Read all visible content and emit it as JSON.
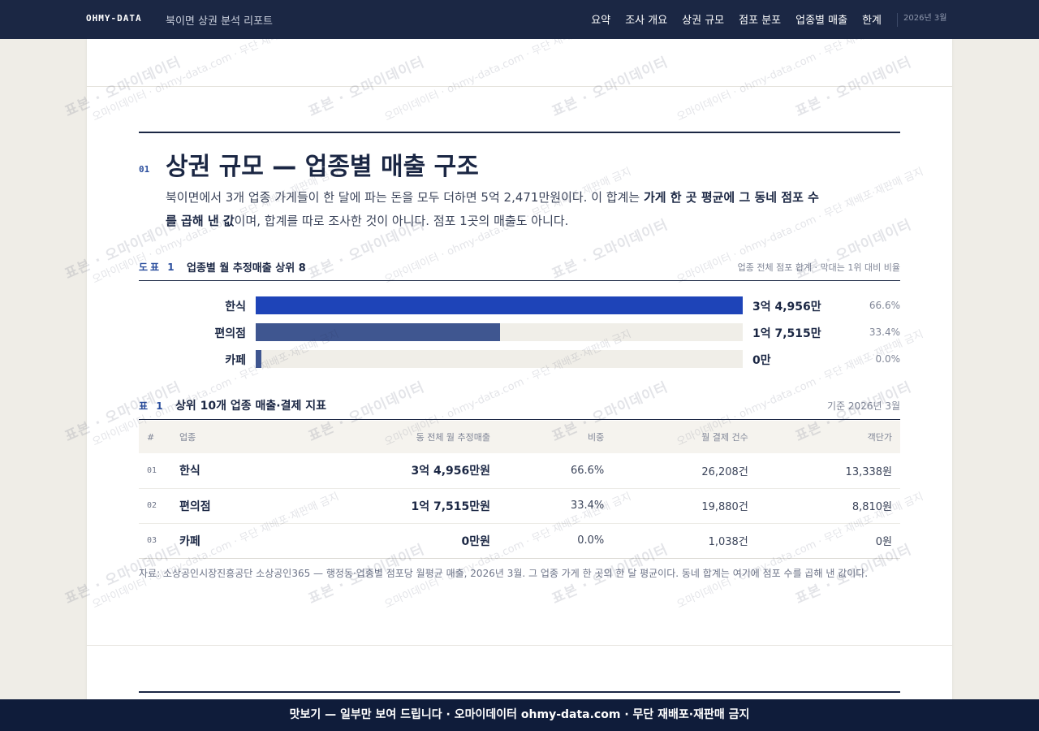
{
  "topbar": {
    "brand": "OHMY-DATA",
    "title": "북이면 상권 분석 리포트",
    "nav": [
      "요약",
      "조사 개요",
      "상권 규모",
      "점포 분포",
      "업종별 매출",
      "한계"
    ],
    "date": "2026년 3월"
  },
  "section": {
    "number": "01",
    "title": "상권 규모 — 업종별 매출 구조",
    "lead_1": "북이면에서 3개 업종 가게들이 한 달에 파는 돈을 모두 더하면 5억 2,471만원이다. 이 합계는 ",
    "lead_bold": "가게 한 곳 평균에 그 동네 점포 수를 곱해 낸 값",
    "lead_2": "이며, 합계를 따로 조사한 것이 아니다. 점포 1곳의 매출도 아니다."
  },
  "figure": {
    "label": "도표 1",
    "title": "업종별 월 추정매출 상위 8",
    "note": "업종 전체 점포 합계 · 막대는 1위 대비 비율",
    "colors": [
      "#1e44b8",
      "#3f5690",
      "#3f5690"
    ]
  },
  "chart_data": {
    "type": "bar",
    "categories": [
      "한식",
      "편의점",
      "카페"
    ],
    "values": [
      1,
      0.502,
      0.012
    ],
    "value_labels": [
      "3억 4,956만",
      "1억 7,515만",
      "0만"
    ],
    "share_labels": [
      "66.6%",
      "33.4%",
      "0.0%"
    ]
  },
  "table": {
    "label": "표 1",
    "title": "상위 10개 업종 매출·결제 지표",
    "note": "기준 2026년 3월",
    "headers": [
      "#",
      "업종",
      "동 전체 월 추정매출",
      "비중",
      "월 결제 건수",
      "객단가"
    ],
    "rows": [
      [
        "01",
        "한식",
        "3억 4,956만원",
        "66.6%",
        "26,208건",
        "13,338원"
      ],
      [
        "02",
        "편의점",
        "1억 7,515만원",
        "33.4%",
        "19,880건",
        "8,810원"
      ],
      [
        "03",
        "카페",
        "0만원",
        "0.0%",
        "1,038건",
        "0원"
      ]
    ]
  },
  "source": "자료: 소상공인시장진흥공단 소상공인365 — 행정동·업종별 점포당 월평균 매출, 2026년 3월. 그 업종 가게 한 곳의 한 달 평균이다. 동네 합계는 여기에 점포 수를 곱해 낸 값이다.",
  "watermark": {
    "text_a": "표본 · 오마이데이터",
    "text_b": "오마이데이터 · ohmy-data.com · 무단 재배포·재판매 금지"
  },
  "footer": "맛보기 — 일부만 보여 드립니다 · 오마이데이터 ohmy-data.com · 무단 재배포·재판매 금지"
}
